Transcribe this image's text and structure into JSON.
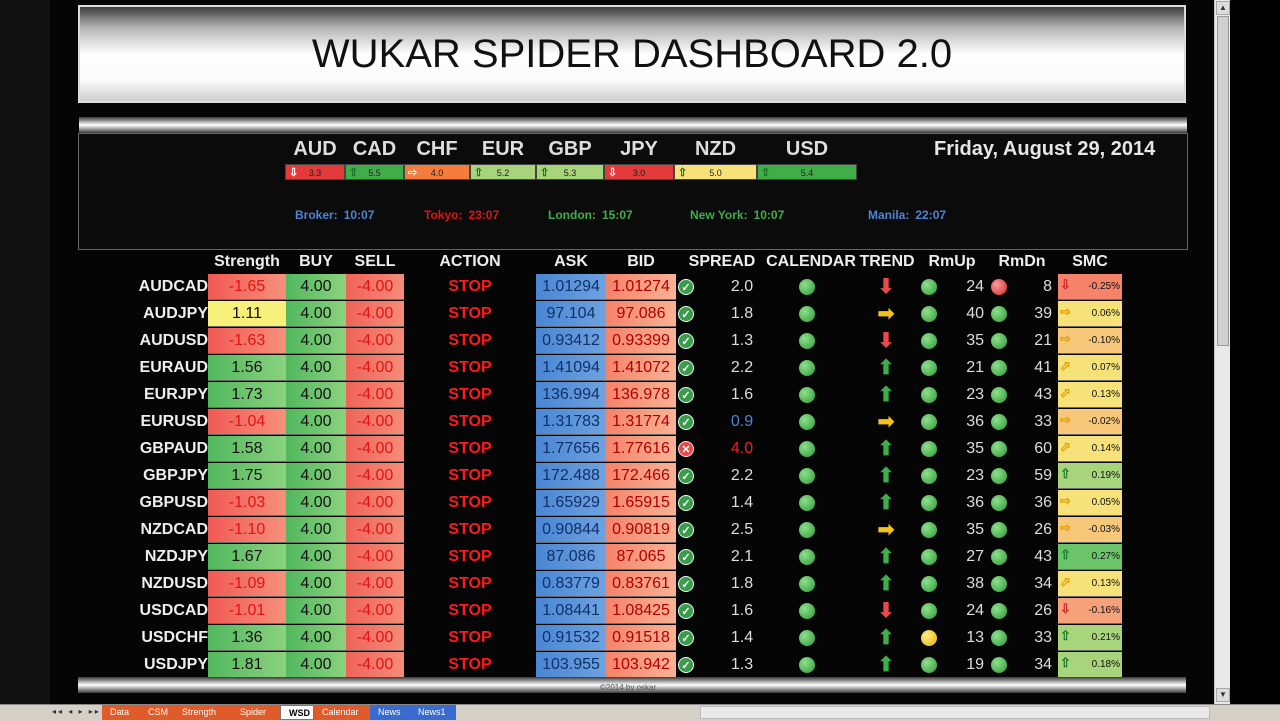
{
  "title": "WUKAR SPIDER DASHBOARD 2.0",
  "date": "Friday, August 29, 2014",
  "currencies": [
    {
      "code": "AUD",
      "value": "3.3",
      "dir": "down",
      "color": "#e43a3a"
    },
    {
      "code": "CAD",
      "value": "5.5",
      "dir": "up",
      "color": "#3fae49"
    },
    {
      "code": "CHF",
      "value": "4.0",
      "dir": "right",
      "color": "#f57c3a"
    },
    {
      "code": "EUR",
      "value": "5.2",
      "dir": "up",
      "color": "#a8d47b"
    },
    {
      "code": "GBP",
      "value": "5.3",
      "dir": "up",
      "color": "#a8d47b"
    },
    {
      "code": "JPY",
      "value": "3.0",
      "dir": "down",
      "color": "#e43a3a"
    },
    {
      "code": "NZD",
      "value": "5.0",
      "dir": "up",
      "color": "#f7e27a"
    },
    {
      "code": "USD",
      "value": "5.4",
      "dir": "up",
      "color": "#3fae49"
    }
  ],
  "clocks": [
    {
      "label": "Broker:",
      "time": "10:07",
      "color": "#4a86d4"
    },
    {
      "label": "Tokyo:",
      "time": "23:07",
      "color": "#e01414"
    },
    {
      "label": "London:",
      "time": "15:07",
      "color": "#3fae49"
    },
    {
      "label": "New York:",
      "time": "10:07",
      "color": "#3fae49"
    },
    {
      "label": "Manila:",
      "time": "22:07",
      "color": "#4a86d4"
    }
  ],
  "headers": {
    "strength": "Strength",
    "buy": "BUY",
    "sell": "SELL",
    "action": "ACTION",
    "ask": "ASK",
    "bid": "BID",
    "spread": "SPREAD",
    "calendar": "CALENDAR",
    "trend": "TREND",
    "rmup": "RmUp",
    "rmdn": "RmDn",
    "smc": "SMC"
  },
  "rows": [
    {
      "pair": "AUDCAD",
      "strength": "-1.65",
      "sclass": "redneg",
      "buy": "4.00",
      "sell": "-4.00",
      "action": "STOP",
      "ask": "1.01294",
      "bid": "1.01274",
      "spread_ok": true,
      "spread": "2.0",
      "spread_color": "#ddd",
      "trend": "down",
      "rmup_dot": "g",
      "rmup": "24",
      "rmdn_dot": "r",
      "rmdn": "8",
      "smc": "-0.25%",
      "smc_dir": "down",
      "smc_color": "#f5836a"
    },
    {
      "pair": "AUDJPY",
      "strength": "1.11",
      "sclass": "yellow-cell",
      "buy": "4.00",
      "sell": "-4.00",
      "action": "STOP",
      "ask": "97.104",
      "bid": "97.086",
      "spread_ok": true,
      "spread": "1.8",
      "spread_color": "#ddd",
      "trend": "right",
      "rmup_dot": "g",
      "rmup": "40",
      "rmdn_dot": "g",
      "rmdn": "39",
      "smc": "0.06%",
      "smc_dir": "right",
      "smc_color": "#f7e27a"
    },
    {
      "pair": "AUDUSD",
      "strength": "-1.63",
      "sclass": "redneg",
      "buy": "4.00",
      "sell": "-4.00",
      "action": "STOP",
      "ask": "0.93412",
      "bid": "0.93399",
      "spread_ok": true,
      "spread": "1.3",
      "spread_color": "#ddd",
      "trend": "down",
      "rmup_dot": "g",
      "rmup": "35",
      "rmdn_dot": "g",
      "rmdn": "21",
      "smc": "-0.10%",
      "smc_dir": "right",
      "smc_color": "#f7c77a"
    },
    {
      "pair": "EURAUD",
      "strength": "1.56",
      "sclass": "green-cell",
      "buy": "4.00",
      "sell": "-4.00",
      "action": "STOP",
      "ask": "1.41094",
      "bid": "1.41072",
      "spread_ok": true,
      "spread": "2.2",
      "spread_color": "#ddd",
      "trend": "up",
      "rmup_dot": "g",
      "rmup": "21",
      "rmdn_dot": "g",
      "rmdn": "41",
      "smc": "0.07%",
      "smc_dir": "upright",
      "smc_color": "#f7e27a"
    },
    {
      "pair": "EURJPY",
      "strength": "1.73",
      "sclass": "green-cell",
      "buy": "4.00",
      "sell": "-4.00",
      "action": "STOP",
      "ask": "136.994",
      "bid": "136.978",
      "spread_ok": true,
      "spread": "1.6",
      "spread_color": "#ddd",
      "trend": "up",
      "rmup_dot": "g",
      "rmup": "23",
      "rmdn_dot": "g",
      "rmdn": "43",
      "smc": "0.13%",
      "smc_dir": "upright",
      "smc_color": "#f7e27a"
    },
    {
      "pair": "EURUSD",
      "strength": "-1.04",
      "sclass": "redneg",
      "buy": "4.00",
      "sell": "-4.00",
      "action": "STOP",
      "ask": "1.31783",
      "bid": "1.31774",
      "spread_ok": true,
      "spread": "0.9",
      "spread_color": "#4a86d4",
      "trend": "right",
      "rmup_dot": "g",
      "rmup": "36",
      "rmdn_dot": "g",
      "rmdn": "33",
      "smc": "-0.02%",
      "smc_dir": "right",
      "smc_color": "#f7c77a"
    },
    {
      "pair": "GBPAUD",
      "strength": "1.58",
      "sclass": "green-cell",
      "buy": "4.00",
      "sell": "-4.00",
      "action": "STOP",
      "ask": "1.77656",
      "bid": "1.77616",
      "spread_ok": false,
      "spread": "4.0",
      "spread_color": "#ff1a1a",
      "trend": "up",
      "rmup_dot": "g",
      "rmup": "35",
      "rmdn_dot": "g",
      "rmdn": "60",
      "smc": "0.14%",
      "smc_dir": "upright",
      "smc_color": "#f7e27a"
    },
    {
      "pair": "GBPJPY",
      "strength": "1.75",
      "sclass": "green-cell",
      "buy": "4.00",
      "sell": "-4.00",
      "action": "STOP",
      "ask": "172.488",
      "bid": "172.466",
      "spread_ok": true,
      "spread": "2.2",
      "spread_color": "#ddd",
      "trend": "up",
      "rmup_dot": "g",
      "rmup": "23",
      "rmdn_dot": "g",
      "rmdn": "59",
      "smc": "0.19%",
      "smc_dir": "up",
      "smc_color": "#a8d47b"
    },
    {
      "pair": "GBPUSD",
      "strength": "-1.03",
      "sclass": "redneg",
      "buy": "4.00",
      "sell": "-4.00",
      "action": "STOP",
      "ask": "1.65929",
      "bid": "1.65915",
      "spread_ok": true,
      "spread": "1.4",
      "spread_color": "#ddd",
      "trend": "up",
      "rmup_dot": "g",
      "rmup": "36",
      "rmdn_dot": "g",
      "rmdn": "36",
      "smc": "0.05%",
      "smc_dir": "right",
      "smc_color": "#f7e27a"
    },
    {
      "pair": "NZDCAD",
      "strength": "-1.10",
      "sclass": "redneg",
      "buy": "4.00",
      "sell": "-4.00",
      "action": "STOP",
      "ask": "0.90844",
      "bid": "0.90819",
      "spread_ok": true,
      "spread": "2.5",
      "spread_color": "#ddd",
      "trend": "right",
      "rmup_dot": "g",
      "rmup": "35",
      "rmdn_dot": "g",
      "rmdn": "26",
      "smc": "-0.03%",
      "smc_dir": "right",
      "smc_color": "#f7c77a"
    },
    {
      "pair": "NZDJPY",
      "strength": "1.67",
      "sclass": "green-cell",
      "buy": "4.00",
      "sell": "-4.00",
      "action": "STOP",
      "ask": "87.086",
      "bid": "87.065",
      "spread_ok": true,
      "spread": "2.1",
      "spread_color": "#ddd",
      "trend": "up",
      "rmup_dot": "g",
      "rmup": "27",
      "rmdn_dot": "g",
      "rmdn": "43",
      "smc": "0.27%",
      "smc_dir": "up",
      "smc_color": "#6cc46a"
    },
    {
      "pair": "NZDUSD",
      "strength": "-1.09",
      "sclass": "redneg",
      "buy": "4.00",
      "sell": "-4.00",
      "action": "STOP",
      "ask": "0.83779",
      "bid": "0.83761",
      "spread_ok": true,
      "spread": "1.8",
      "spread_color": "#ddd",
      "trend": "up",
      "rmup_dot": "g",
      "rmup": "38",
      "rmdn_dot": "g",
      "rmdn": "34",
      "smc": "0.13%",
      "smc_dir": "upright",
      "smc_color": "#f7e27a"
    },
    {
      "pair": "USDCAD",
      "strength": "-1.01",
      "sclass": "redneg",
      "buy": "4.00",
      "sell": "-4.00",
      "action": "STOP",
      "ask": "1.08441",
      "bid": "1.08425",
      "spread_ok": true,
      "spread": "1.6",
      "spread_color": "#ddd",
      "trend": "down",
      "rmup_dot": "g",
      "rmup": "24",
      "rmdn_dot": "g",
      "rmdn": "26",
      "smc": "-0.16%",
      "smc_dir": "down",
      "smc_color": "#f5a27a"
    },
    {
      "pair": "USDCHF",
      "strength": "1.36",
      "sclass": "green-cell",
      "buy": "4.00",
      "sell": "-4.00",
      "action": "STOP",
      "ask": "0.91532",
      "bid": "0.91518",
      "spread_ok": true,
      "spread": "1.4",
      "spread_color": "#ddd",
      "trend": "up",
      "rmup_dot": "y",
      "rmup": "13",
      "rmdn_dot": "g",
      "rmdn": "33",
      "smc": "0.21%",
      "smc_dir": "up",
      "smc_color": "#a8d47b"
    },
    {
      "pair": "USDJPY",
      "strength": "1.81",
      "sclass": "green-cell",
      "buy": "4.00",
      "sell": "-4.00",
      "action": "STOP",
      "ask": "103.955",
      "bid": "103.942",
      "spread_ok": true,
      "spread": "1.3",
      "spread_color": "#ddd",
      "trend": "up",
      "rmup_dot": "g",
      "rmup": "19",
      "rmdn_dot": "g",
      "rmdn": "34",
      "smc": "0.18%",
      "smc_dir": "up",
      "smc_color": "#a8d47b"
    }
  ],
  "footer": "©2014 by oskar",
  "sheet_tabs": [
    {
      "label": "Data",
      "active": false
    },
    {
      "label": "CSM",
      "active": false
    },
    {
      "label": "Strength",
      "active": false
    },
    {
      "label": "Spider",
      "active": false
    },
    {
      "label": "WSD",
      "active": true
    },
    {
      "label": "Calendar",
      "active": false
    },
    {
      "label": "News",
      "active": false
    },
    {
      "label": "News1",
      "active": false
    }
  ]
}
